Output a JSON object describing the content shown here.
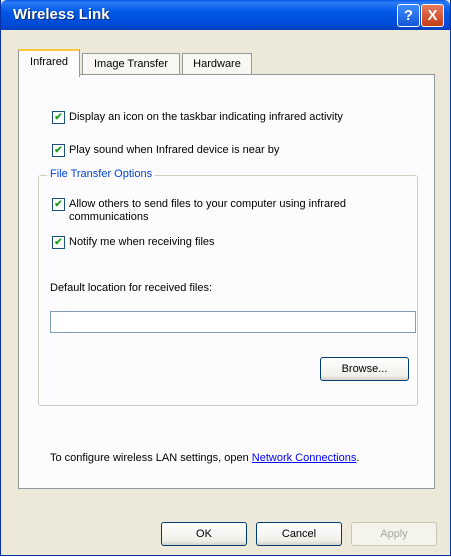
{
  "window": {
    "title": "Wireless Link",
    "help_symbol": "?",
    "close_symbol": "X"
  },
  "tabs": [
    {
      "label": "Infrared",
      "active": true
    },
    {
      "label": "Image Transfer",
      "active": false
    },
    {
      "label": "Hardware",
      "active": false
    }
  ],
  "options": {
    "display_icon": {
      "label": "Display an icon on the taskbar indicating infrared activity",
      "checked": true
    },
    "play_sound": {
      "label": "Play sound when Infrared device is near by",
      "checked": true
    }
  },
  "file_transfer": {
    "group_title": "File Transfer Options",
    "allow_others": {
      "label_line1": "Allow others to send files to your computer using infrared",
      "label_line2": "communications",
      "checked": true
    },
    "notify": {
      "label": "Notify me when receiving files",
      "checked": true
    },
    "location_label": "Default location for received files:",
    "location_value": "",
    "browse_label": "Browse..."
  },
  "footer": {
    "text": "To configure wireless LAN settings, open ",
    "link_text": "Network Connections",
    "period": "."
  },
  "buttons": {
    "ok": "OK",
    "cancel": "Cancel",
    "apply": "Apply"
  },
  "icons": {
    "checkmark": "check-icon"
  },
  "colors": {
    "titlebar": "#0058e6",
    "accent_tab": "#ffc83c",
    "group_title": "#0046d5",
    "link": "#0000ff",
    "check": "#21a121"
  }
}
